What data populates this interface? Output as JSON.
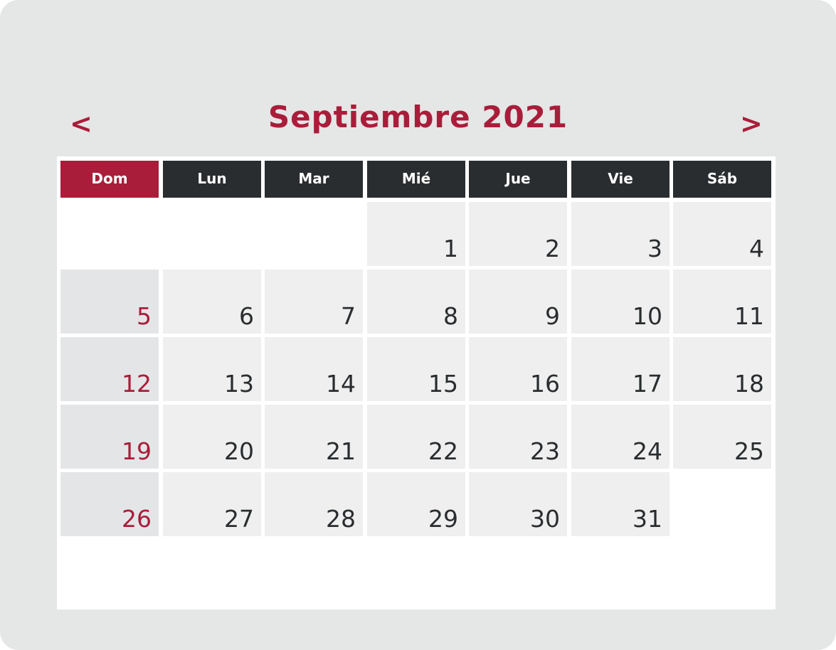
{
  "calendar": {
    "title": "Septiembre 2021",
    "prev_label": "<",
    "next_label": ">",
    "weekdays": [
      "Dom",
      "Lun",
      "Mar",
      "Mié",
      "Jue",
      "Vie",
      "Sáb"
    ],
    "weeks": [
      [
        "",
        "",
        "",
        "1",
        "2",
        "3",
        "4"
      ],
      [
        "5",
        "6",
        "7",
        "8",
        "9",
        "10",
        "11"
      ],
      [
        "12",
        "13",
        "14",
        "15",
        "16",
        "17",
        "18"
      ],
      [
        "19",
        "20",
        "21",
        "22",
        "23",
        "24",
        "25"
      ],
      [
        "26",
        "27",
        "28",
        "29",
        "30",
        "31",
        ""
      ]
    ]
  },
  "colors": {
    "accent": "#a91d3a",
    "header_dark": "#2a2d2f",
    "cell_bg": "#efefef",
    "sunday_cell_bg": "#e4e5e7",
    "frame_bg": "#e5e6e6"
  }
}
